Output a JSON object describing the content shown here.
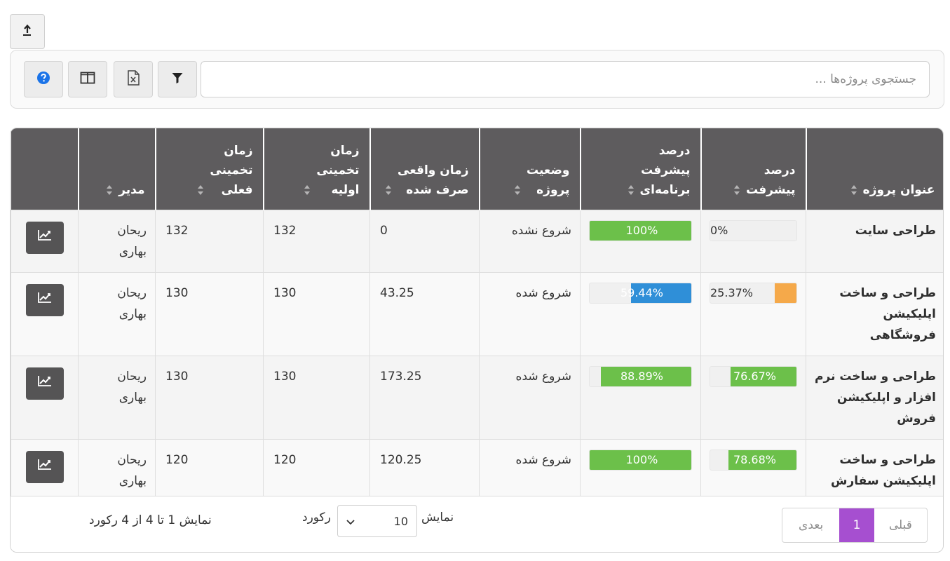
{
  "toolbar": {
    "search_placeholder": "جستجوی پروژه‌ها ..."
  },
  "icons": {
    "export": "export-icon",
    "filter": "filter-icon",
    "excel": "excel-file-icon",
    "columns": "columns-icon",
    "help": "help-icon"
  },
  "colors": {
    "header_bg": "#5e5c5e",
    "progress_green": "#6cc04a",
    "progress_blue": "#2f8fd8",
    "progress_orange": "#f5a94a",
    "pager_active": "#a64fd0",
    "help_icon": "#1a73e8"
  },
  "table": {
    "headers": {
      "title": "عنوان پروژه",
      "progress_l1": "درصد",
      "progress_l2": "پیشرفت",
      "planned_l1": "درصد",
      "planned_l2": "پیشرفت",
      "planned_l3": "برنامه‌ای",
      "status_l1": "وضعیت",
      "status_l2": "پروژه",
      "actual_l1": "زمان واقعی",
      "actual_l2": "صرف شده",
      "initial_l1": "زمان",
      "initial_l2": "تخمینی",
      "initial_l3": "اولیه",
      "current_l1": "زمان",
      "current_l2": "تخمینی",
      "current_l3": "فعلی",
      "manager": "مدیر"
    },
    "rows": [
      {
        "title": "طراحی سایت",
        "progress": 0,
        "progress_label": "0%",
        "planned": 100,
        "planned_label": "100%",
        "status": "شروع نشده",
        "actual": "0",
        "initial": "132",
        "current": "132",
        "manager": "ریحان بهاری"
      },
      {
        "title": "طراحی و ساخت اپلیکیشن فروشگاهی",
        "progress": 25.37,
        "progress_label": "25.37%",
        "planned": 59.44,
        "planned_label": "59.44%",
        "status": "شروع شده",
        "actual": "43.25",
        "initial": "130",
        "current": "130",
        "manager": "ریحان بهاری"
      },
      {
        "title": "طراحی و ساخت نرم افزار و اپلیکیشن فروش",
        "progress": 76.67,
        "progress_label": "76.67%",
        "planned": 88.89,
        "planned_label": "88.89%",
        "status": "شروع شده",
        "actual": "173.25",
        "initial": "130",
        "current": "130",
        "manager": "ریحان بهاری"
      },
      {
        "title": "طراحی و ساخت اپلیکیشن سفارش غذا",
        "progress": 78.68,
        "progress_label": "78.68%",
        "planned": 100,
        "planned_label": "100%",
        "status": "شروع شده",
        "actual": "120.25",
        "initial": "120",
        "current": "120",
        "manager": "ریحان بهاری"
      }
    ]
  },
  "footer": {
    "prev": "قبلی",
    "page": "1",
    "next": "بعدی",
    "show": "نمایش",
    "page_size": "10",
    "records": "رکورد",
    "summary": "نمایش 1 تا 4 از 4 رکورد"
  }
}
